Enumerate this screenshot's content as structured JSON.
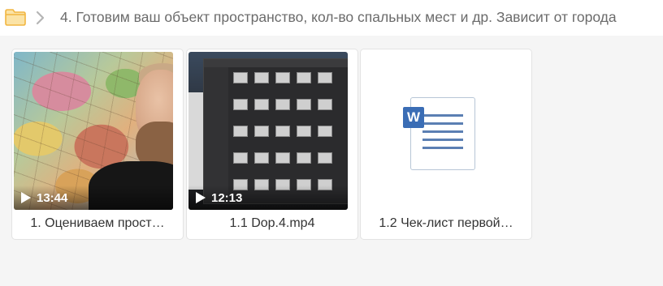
{
  "breadcrumb": {
    "folder_icon": "folder-icon",
    "separator_icon": "chevron-right-icon",
    "title": "4. Готовим ваш объект пространство, кол-во спальных мест и др. Зависит от города"
  },
  "files": [
    {
      "type": "video",
      "duration": "13:44",
      "name": "1. Оцениваем прост…",
      "icon": "play-icon"
    },
    {
      "type": "video",
      "duration": "12:13",
      "name": "1.1 Dop.4.mp4",
      "icon": "play-icon"
    },
    {
      "type": "document",
      "badge": "W",
      "name": "1.2 Чек-лист первой…",
      "icon": "word-document-icon"
    }
  ],
  "colors": {
    "folder": "#f6c35c",
    "word_blue": "#3a6db5",
    "background": "#f5f5f5"
  }
}
